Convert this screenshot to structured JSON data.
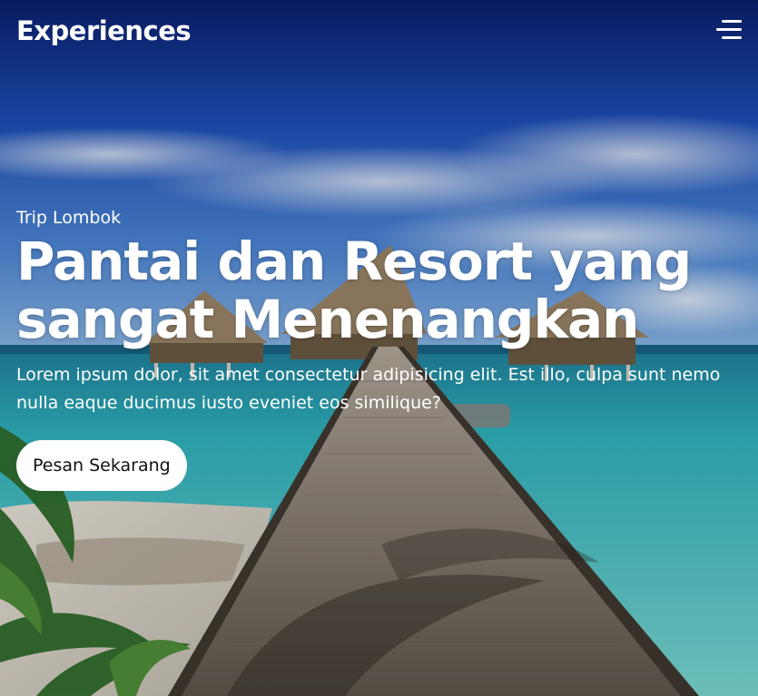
{
  "navbar": {
    "logo": "Experiences",
    "menu_icon": "hamburger-menu-icon"
  },
  "hero": {
    "eyebrow": "Trip Lombok",
    "headline": "Pantai dan Resort yang sangat Menenangkan",
    "description": "Lorem ipsum dolor, sit amet consectetur adipisicing elit. Est illo, culpa sunt nemo nulla eaque ducimus iusto eveniet eos similique?",
    "cta_label": "Pesan Sekarang",
    "background_image": "beach-resort-boardwalk-photo"
  },
  "colors": {
    "text": "#ffffff",
    "button_bg": "#ffffff",
    "button_text": "#111111",
    "sky_top": "#0a1f6e",
    "sea": "#3fc1c9"
  }
}
